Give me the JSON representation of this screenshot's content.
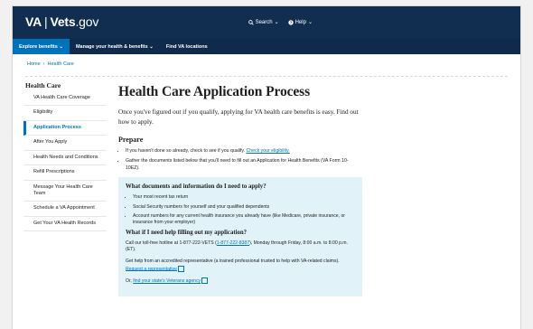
{
  "header": {
    "logo_va": "VA",
    "logo_divider": "|",
    "logo_vets": "Vets",
    "logo_gov": ".gov",
    "search_label": "Search",
    "help_label": "Help"
  },
  "nav": {
    "items": [
      {
        "label": "Explore benefits"
      },
      {
        "label": "Manage your health & benefits"
      },
      {
        "label": "Find VA locations"
      }
    ]
  },
  "breadcrumb": {
    "home": "Home",
    "sep": "›",
    "current": "Health Care"
  },
  "sidebar": {
    "heading": "Health Care",
    "items": [
      {
        "label": "VA Health Care Coverage"
      },
      {
        "label": "Eligibility"
      },
      {
        "label": "Application Process"
      },
      {
        "label": "After You Apply"
      },
      {
        "label": "Health Needs and Conditions"
      },
      {
        "label": "Refill Prescriptions"
      },
      {
        "label": "Message Your Health Care Team"
      },
      {
        "label": "Schedule a VA Appointment"
      },
      {
        "label": "Get Your VA Health Records"
      }
    ]
  },
  "main": {
    "title": "Health Care Application Process",
    "intro": "Once you've figured out if you qualify, applying for VA health care benefits is easy. Find out how to apply.",
    "prepare_heading": "Prepare",
    "prepare_1_pre": "If you haven't done so already, check to see if you qualify. ",
    "prepare_1_link": "Check your eligibility.",
    "prepare_2": "Gather the documents listed below that you'll need to fill out an Application for Health Benefits (VA Form 10-10EZ).",
    "box": {
      "heading1": "What documents and information do I need to apply?",
      "doc_1": "Your most recent tax return",
      "doc_2": "Social Security numbers for yourself and your qualified dependents",
      "doc_3": "Account numbers for any current health insurance you already have (like Medicare, private insurance, or insurance from your employer)",
      "heading2": "What if I need help filling out my application?",
      "call_pre": "Call our toll-free hotline at 1-877-222-VETS (",
      "call_link": "1-877-222-8387",
      "call_post": "), Monday through Friday, 8:00 a.m. to 8:00 p.m. (ET).",
      "rep_pre": "Get help from an accredited representative (a trained professional trusted to help with VA-related claims). ",
      "rep_link": "Request a representative",
      "agency_pre": "Or, ",
      "agency_link": "find your state's Veterans agency"
    }
  }
}
